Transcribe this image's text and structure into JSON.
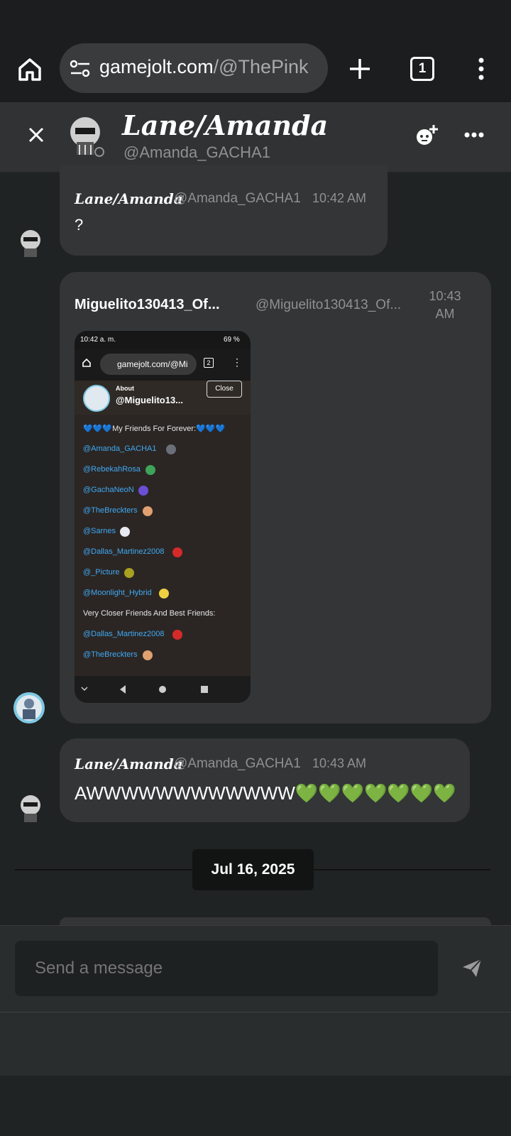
{
  "browser": {
    "url_host": "gamejolt.com",
    "url_path": "/@ThePink",
    "tab_count": "1"
  },
  "chat": {
    "display_name": "Lane/Amanda",
    "handle": "@Amanda_GACHA1"
  },
  "messages": [
    {
      "author": "Lane/Amanda",
      "handle": "@Amanda_GACHA1",
      "time": "10:42 AM",
      "text": "?"
    },
    {
      "author": "Miguelito130413_Of...",
      "handle": "@Miguelito130413_Of...",
      "time_line1": "10:43",
      "time_line2": "AM",
      "attachment": {
        "status_time": "10:42 a. m.",
        "battery": "69 %",
        "url": "gamejolt.com/@Mi",
        "tabs": "2",
        "about_label": "About",
        "profile_handle": "@Miguelito13...",
        "close_label": "Close",
        "friends_heading": "💙💙💙My Friends For Forever:💙💙💙",
        "friends": [
          "@Amanda_GACHA1",
          "@RebekahRosa",
          "@GachaNeoN",
          "@TheBreckters",
          "@Sarnes",
          "@Dallas_Martinez2008",
          "@_Picture",
          "@Moonlight_Hybrid"
        ],
        "best_heading": "Very Closer Friends And Best Friends:",
        "best_friends": [
          "@Dallas_Martinez2008",
          "@TheBreckters"
        ]
      }
    },
    {
      "author": "Lane/Amanda",
      "handle": "@Amanda_GACHA1",
      "time": "10:43 AM",
      "text": "AWWWWWWWWWWWW💚💚💚💚💚💚💚"
    }
  ],
  "date_divider": "Jul 16, 2025",
  "composer": {
    "placeholder": "Send a message"
  },
  "icons": {
    "home": "home-icon",
    "site_settings": "tune-icon",
    "new_tab": "plus-icon",
    "menu": "more-vertical-icon",
    "close": "close-icon",
    "add_friend": "add-friend-icon",
    "more": "more-horizontal-icon",
    "send": "send-icon"
  },
  "colors": {
    "background": "#202323",
    "bubble": "#333536",
    "header": "#303233",
    "link": "#3fa9f5"
  }
}
